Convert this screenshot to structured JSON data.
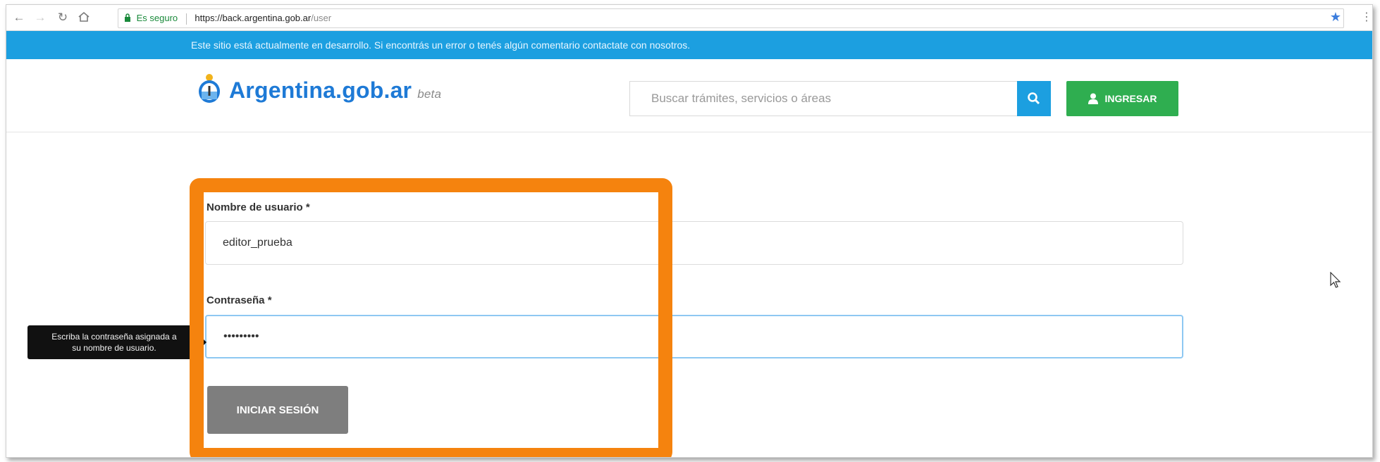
{
  "browser": {
    "secure_label": "Es seguro",
    "url_host": "https://back.argentina.gob.ar",
    "url_path": "/user"
  },
  "banner": {
    "text": "Este sitio está actualmente en desarrollo. Si encontrás un error o tenés algún comentario contactate con nosotros."
  },
  "header": {
    "logo_text": "Argentina.gob.ar",
    "logo_beta": "beta",
    "search_placeholder": "Buscar trámites, servicios o áreas",
    "login_label": "INGRESAR"
  },
  "form": {
    "username_label": "Nombre de usuario *",
    "username_value": "editor_prueba",
    "password_label": "Contraseña *",
    "password_value": "•••••••••",
    "submit_label": "INICIAR SESIÓN"
  },
  "tooltip": {
    "line1": "Escriba la contraseña asignada a",
    "line2": "su nombre de usuario."
  },
  "colors": {
    "banner_bg": "#1c9fe0",
    "brand_blue": "#1e7ad6",
    "login_green": "#2fae50",
    "highlight_orange": "#f5830e",
    "submit_gray": "#7e7e7e"
  }
}
